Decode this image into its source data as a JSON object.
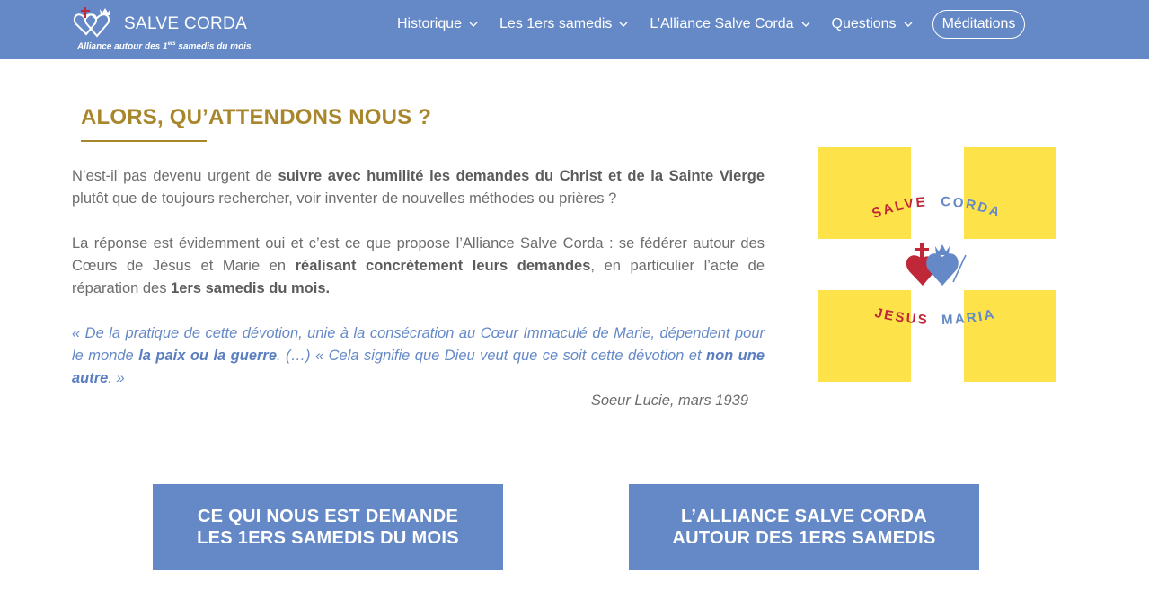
{
  "header": {
    "logo_title": "SALVE CORDA",
    "logo_tagline_pre": "Alliance autour des 1",
    "logo_tagline_sup": "ers",
    "logo_tagline_post": " samedis du mois",
    "nav": [
      {
        "label": "Historique",
        "icon": "chevron-down-icon"
      },
      {
        "label": "Les 1ers samedis",
        "icon": "chevron-down-icon"
      },
      {
        "label": "L’Alliance Salve Corda",
        "icon": "chevron-down-icon"
      },
      {
        "label": "Questions",
        "icon": "chevron-down-icon"
      }
    ],
    "cta_label": "Méditations"
  },
  "main": {
    "title": "ALORS, QU’ATTENDONS NOUS ?",
    "p1": {
      "t1": "N’est-il pas devenu urgent de ",
      "b1": "suivre avec humilité les demandes du Christ et de la Sainte Vierge",
      "t2": " plutôt que de toujours rechercher, voir inventer de nouvelles méthodes ou prières ?"
    },
    "p2": {
      "t1": "La réponse est évidemment oui et c’est ce que propose l’Alliance Salve Corda : se fédérer autour des Cœurs de Jésus et Marie en ",
      "b1": "réalisant concrètement leurs demandes",
      "t2": ", en particulier l’acte de réparation des ",
      "b2": "1ers samedis du mois."
    },
    "quote": {
      "t1": "« De la pratique de cette dévotion, unie à la consécration au Cœur Immaculé de Marie, dépendent pour le monde ",
      "b1": "la paix ou la guerre",
      "t2": ".  (…) « Cela signifie que Dieu veut que ce soit cette dévotion et ",
      "b2": "non une autre",
      "t3": ". »"
    },
    "signature": "Soeur Lucie, mars 1939"
  },
  "emblem": {
    "top_text_left": "SALVE",
    "top_text_right": "CORDA",
    "bottom_text_left": "JESUS",
    "bottom_text_right": "MARIA",
    "colors": {
      "yellow": "#fde24a",
      "red": "#c0283a",
      "blue": "#6589c7"
    }
  },
  "cta": [
    {
      "line1": "CE QUI NOUS EST DEMANDE",
      "line2": "LES 1ERS SAMEDIS DU MOIS"
    },
    {
      "line1": "L’ALLIANCE SALVE CORDA",
      "line2": "AUTOUR DES 1ERS SAMEDIS"
    }
  ],
  "colors": {
    "brand_blue": "#6589c7",
    "title_gold": "#a8862c",
    "text_gray": "#6d6d6d"
  }
}
